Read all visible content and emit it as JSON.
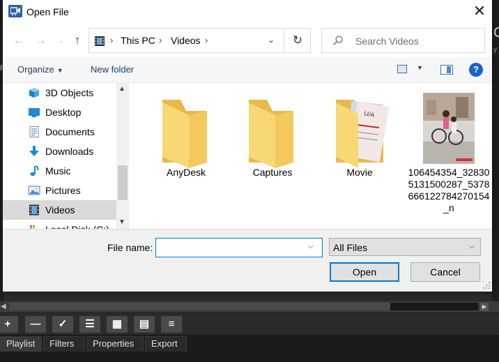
{
  "window": {
    "title": "Open File",
    "close_glyph": "✕"
  },
  "nav": {
    "back_glyph": "←",
    "forward_glyph": "→",
    "recent_glyph": "⌄",
    "up_glyph": "↑",
    "refresh_glyph": "↻"
  },
  "address": {
    "segments": [
      "This PC",
      "Videos"
    ],
    "sep": "›"
  },
  "search": {
    "placeholder": "Search Videos"
  },
  "commands": {
    "organize": "Organize",
    "organize_caret": "▼",
    "new_folder": "New folder",
    "view_caret": "▼",
    "help_glyph": "?"
  },
  "sidebar": {
    "items": [
      {
        "label": "3D Objects",
        "icon": "3d-objects-icon"
      },
      {
        "label": "Desktop",
        "icon": "desktop-icon"
      },
      {
        "label": "Documents",
        "icon": "documents-icon"
      },
      {
        "label": "Downloads",
        "icon": "downloads-icon"
      },
      {
        "label": "Music",
        "icon": "music-icon"
      },
      {
        "label": "Pictures",
        "icon": "pictures-icon"
      },
      {
        "label": "Videos",
        "icon": "videos-icon",
        "selected": true
      },
      {
        "label": "Local Disk (C:)",
        "icon": "local-disk-icon"
      }
    ],
    "scroll_up": "▲",
    "scroll_down": "▼"
  },
  "files": [
    {
      "name": "AnyDesk",
      "type": "folder"
    },
    {
      "name": "Captures",
      "type": "folder"
    },
    {
      "name": "Movie",
      "type": "folder-with-content"
    },
    {
      "name": "106454354_328305131500287_5378666122784270154_n",
      "type": "image"
    }
  ],
  "footer": {
    "filename_label": "File name:",
    "filename_value": "",
    "filename_caret": "⌵",
    "filetype_value": "All Files",
    "filetype_caret": "⌵",
    "open_label": "Open",
    "cancel_label": "Cancel"
  },
  "background_app": {
    "toolbar_buttons": [
      "+",
      "—",
      "✓",
      "☰",
      "▦",
      "▤",
      "≡"
    ],
    "tabs": [
      "Playlist",
      "Filters",
      "Properties",
      "Export"
    ],
    "scroll_left": "◀",
    "scroll_right": "▶"
  },
  "colors": {
    "accent": "#0078d7",
    "folder": "#f8d775",
    "folder_dark": "#e9b949",
    "help": "#1a62c5"
  }
}
